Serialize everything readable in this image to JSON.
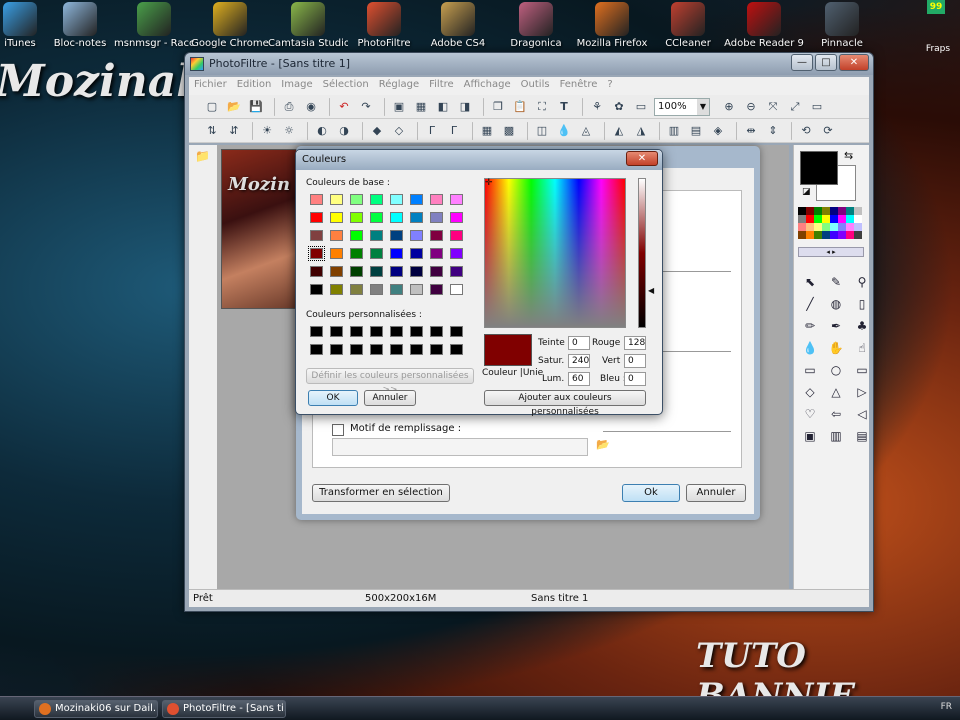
{
  "desktop": {
    "icons": [
      {
        "label": "iTunes",
        "color": "#3aa0e6"
      },
      {
        "label": "Bloc-notes",
        "color": "#8fb8dd"
      },
      {
        "label": "msnmsgr - Raccourci",
        "color": "#4aa04a"
      },
      {
        "label": "Google Chrome",
        "color": "#e0b020"
      },
      {
        "label": "Camtasia Studio",
        "color": "#8ab84a"
      },
      {
        "label": "PhotoFiltre",
        "color": "#e05030"
      },
      {
        "label": "Adobe CS4",
        "color": "#c8a050"
      },
      {
        "label": "Dragonica",
        "color": "#c06080"
      },
      {
        "label": "Mozilla Firefox",
        "color": "#e07020"
      },
      {
        "label": "CCleaner",
        "color": "#c04030"
      },
      {
        "label": "Adobe Reader 9",
        "color": "#c01010"
      },
      {
        "label": "Pinnacle",
        "color": "#506070"
      }
    ],
    "wallpaper_left": "Mozinaki",
    "wallpaper_right": "TUTO BANNIE",
    "corner_badge": "99",
    "corner_label": "Fraps"
  },
  "window": {
    "title": "PhotoFiltre - [Sans titre 1]",
    "controls": {
      "minimize": "—",
      "maximize": "□",
      "close": "✕"
    },
    "menu": [
      "Fichier",
      "Edition",
      "Image",
      "Sélection",
      "Réglage",
      "Filtre",
      "Affichage",
      "Outils",
      "Fenêtre",
      "?"
    ],
    "zoom": "100%",
    "canvas_text": "Mozin",
    "status": {
      "left": "Prêt",
      "middle": "500x200x16M",
      "right": "Sans titre 1"
    }
  },
  "bg_dialog": {
    "motif_label": "Motif de remplissage :",
    "transform_label": "Transformer en sélection",
    "ok_label": "Ok",
    "cancel_label": "Annuler"
  },
  "color_dialog": {
    "title": "Couleurs",
    "close": "✕",
    "basic_label": "Couleurs de base :",
    "custom_label": "Couleurs personnalisées :",
    "define_label": "Définir les couleurs personnalisées >>",
    "ok_label": "OK",
    "cancel_label": "Annuler",
    "add_label": "Ajouter aux couleurs personnalisées",
    "swatch_label": "Couleur |Unie",
    "fields": {
      "teinte": {
        "label": "Teinte :",
        "value": "0"
      },
      "satur": {
        "label": "Satur. :",
        "value": "240"
      },
      "lum": {
        "label": "Lum. :",
        "value": "60"
      },
      "rouge": {
        "label": "Rouge :",
        "value": "128"
      },
      "vert": {
        "label": "Vert :",
        "value": "0"
      },
      "bleu": {
        "label": "Bleu :",
        "value": "0"
      }
    },
    "selected_color": "#800000",
    "basic_colors": [
      "#ff8080",
      "#ffff80",
      "#80ff80",
      "#00ff80",
      "#80ffff",
      "#0080ff",
      "#ff80c0",
      "#ff80ff",
      "#ff0000",
      "#ffff00",
      "#80ff00",
      "#00ff40",
      "#00ffff",
      "#0080c0",
      "#8080c0",
      "#ff00ff",
      "#804040",
      "#ff8040",
      "#00ff00",
      "#008080",
      "#004080",
      "#8080ff",
      "#800040",
      "#ff0080",
      "#800000",
      "#ff8000",
      "#008000",
      "#008040",
      "#0000ff",
      "#0000a0",
      "#800080",
      "#8000ff",
      "#400000",
      "#804000",
      "#004000",
      "#004040",
      "#000080",
      "#000040",
      "#400040",
      "#400080",
      "#000000",
      "#808000",
      "#808040",
      "#808080",
      "#408080",
      "#c0c0c0",
      "#400040",
      "#ffffff"
    ]
  },
  "panel": {
    "palette": [
      "#000",
      "#800000",
      "#008000",
      "#808000",
      "#000080",
      "#800080",
      "#008080",
      "#c0c0c0",
      "#808080",
      "#f00",
      "#0f0",
      "#ff0",
      "#00f",
      "#f0f",
      "#0ff",
      "#fff",
      "#ff8080",
      "#ffc080",
      "#ffff80",
      "#80ff80",
      "#80ffff",
      "#8080ff",
      "#ff80ff",
      "#c0c0ff",
      "#804000",
      "#ff8000",
      "#408000",
      "#004080",
      "#4000ff",
      "#8000ff",
      "#ff0080",
      "#404040"
    ],
    "tools": [
      "⬉",
      "✎",
      "⚲",
      "╱",
      "◍",
      "▯",
      "✏",
      "✒",
      "♣",
      "💧",
      "✋",
      "☝",
      "▭",
      "○",
      "▭",
      "◇",
      "△",
      "▷",
      "♡",
      "⇦",
      "◁",
      "▣",
      "▥",
      "▤"
    ]
  },
  "taskbar": {
    "tasks": [
      {
        "label": "Mozinaki06 sur Dail...",
        "color": "#e07020"
      },
      {
        "label": "PhotoFiltre - [Sans ti...",
        "color": "#e05030"
      }
    ],
    "tray": "FR"
  }
}
